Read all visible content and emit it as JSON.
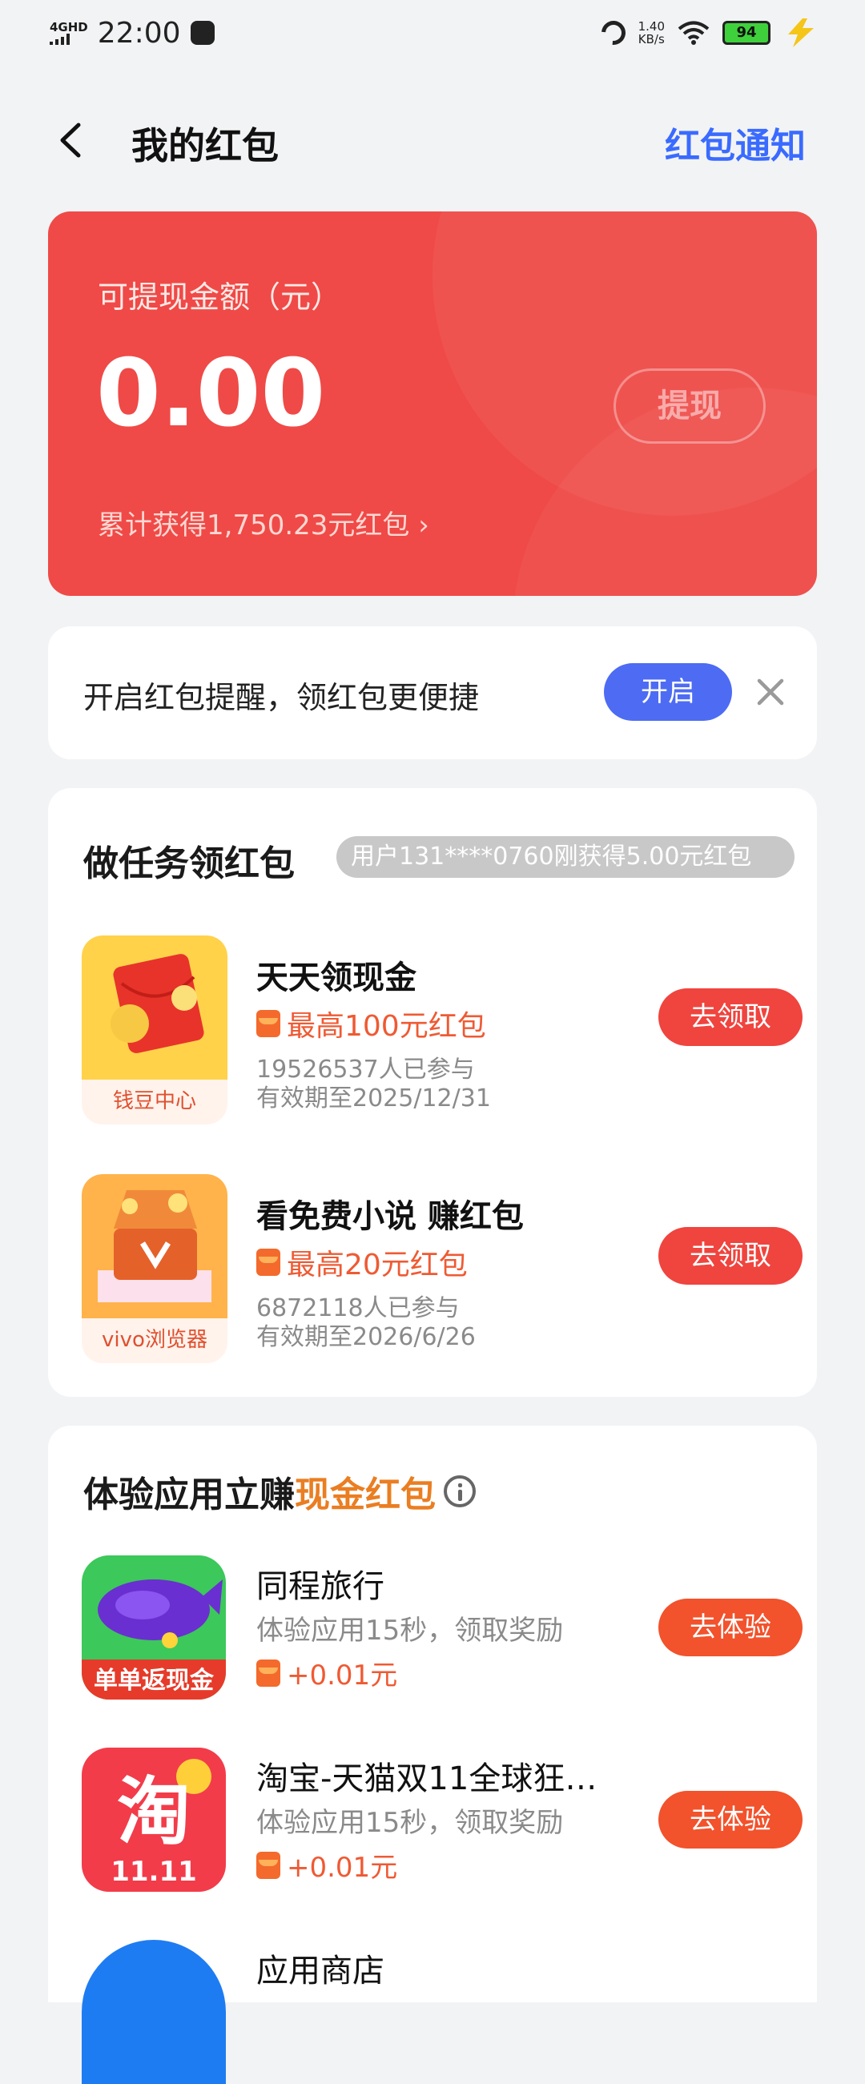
{
  "status": {
    "network": "4GHD",
    "time": "22:00",
    "speed_top": "1.40",
    "speed_unit": "KB/s",
    "battery": "94"
  },
  "header": {
    "title": "我的红包",
    "notice_link": "红包通知"
  },
  "balance": {
    "label": "可提现金额（元）",
    "amount": "0.00",
    "withdraw": "提现",
    "total": "累计获得1,750.23元红包 ›"
  },
  "reminder": {
    "text": "开启红包提醒，领红包更便捷",
    "button": "开启"
  },
  "tasks": {
    "title": "做任务领红包",
    "ticker": "用户131****0760刚获得5.00元红包",
    "items": [
      {
        "caption": "钱豆中心",
        "name": "天天领现金",
        "reward": "最高100元红包",
        "participants": "19526537人已参与",
        "expiry": "有效期至2025/12/31",
        "button": "去领取"
      },
      {
        "caption": "vivo浏览器",
        "name": "看免费小说 赚红包",
        "reward": "最高20元红包",
        "participants": "6872118人已参与",
        "expiry": "有效期至2026/6/26",
        "button": "去领取"
      }
    ]
  },
  "experience": {
    "title_plain": "体验应用立赚",
    "title_highlight": "现金红包",
    "apps": [
      {
        "icon_text": "单单返现金",
        "name": "同程旅行",
        "desc": "体验应用15秒，领取奖励",
        "reward": "+0.01元",
        "button": "去体验"
      },
      {
        "icon_text": "淘",
        "icon_sub": "11.11",
        "name": "淘宝-天猫双11全球狂…",
        "desc": "体验应用15秒，领取奖励",
        "reward": "+0.01元",
        "button": "去体验"
      },
      {
        "name": "应用商店"
      }
    ]
  },
  "colors": {
    "red_card": "#ef4a47",
    "accent_blue": "#3a6bff",
    "button_red": "#f0443e",
    "button_orange": "#f2522c",
    "highlight": "#ea7e22"
  }
}
